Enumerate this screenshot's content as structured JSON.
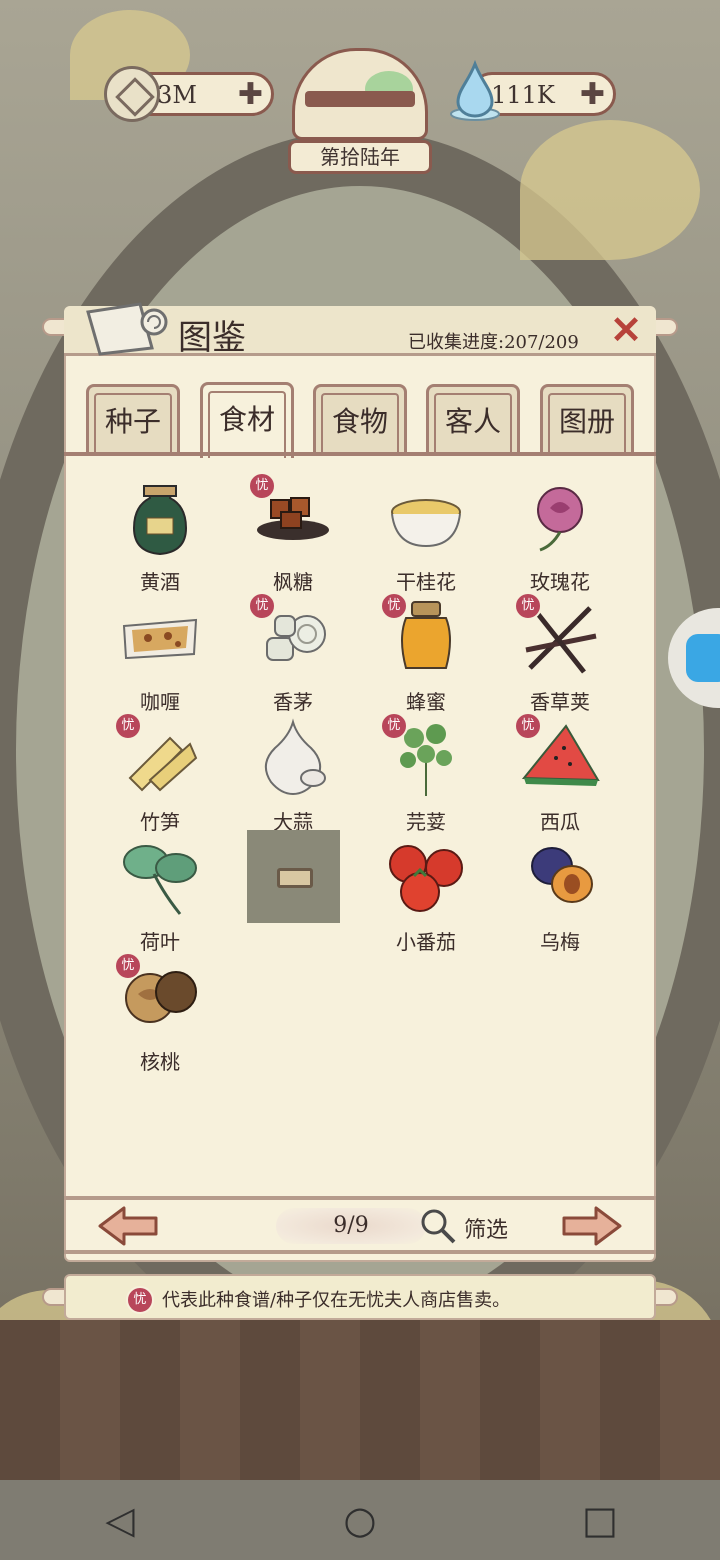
{
  "hud": {
    "coins": "3M",
    "water": "111K",
    "year": "第拾陆年"
  },
  "panel": {
    "title": "图鉴",
    "progress": "已收集进度:207/209"
  },
  "tabs": [
    {
      "label": "种子",
      "active": false
    },
    {
      "label": "食材",
      "active": true
    },
    {
      "label": "食物",
      "active": false
    },
    {
      "label": "客人",
      "active": false
    },
    {
      "label": "图册",
      "active": false
    }
  ],
  "items": [
    {
      "name": "黄酒",
      "exclusive": false
    },
    {
      "name": "枫糖",
      "exclusive": true
    },
    {
      "name": "干桂花",
      "exclusive": false
    },
    {
      "name": "玫瑰花",
      "exclusive": false
    },
    {
      "name": "咖喱",
      "exclusive": false
    },
    {
      "name": "香茅",
      "exclusive": true
    },
    {
      "name": "蜂蜜",
      "exclusive": true
    },
    {
      "name": "香草荚",
      "exclusive": true
    },
    {
      "name": "竹笋",
      "exclusive": true
    },
    {
      "name": "大蒜",
      "exclusive": false
    },
    {
      "name": "芫荽",
      "exclusive": true
    },
    {
      "name": "西瓜",
      "exclusive": true
    },
    {
      "name": "荷叶",
      "exclusive": false
    },
    {
      "name": "",
      "exclusive": false,
      "locked": true
    },
    {
      "name": "小番茄",
      "exclusive": false
    },
    {
      "name": "乌梅",
      "exclusive": false
    },
    {
      "name": "核桃",
      "exclusive": true
    }
  ],
  "badge_char": "忧",
  "pager": {
    "page": "9/9",
    "filter": "筛选"
  },
  "note": "代表此种食谱/种子仅在无忧夫人商店售卖。",
  "colors": {
    "accent": "#8a5a4e",
    "badge": "#b8465a",
    "close": "#b7423a",
    "paper": "#f7f1dc"
  }
}
